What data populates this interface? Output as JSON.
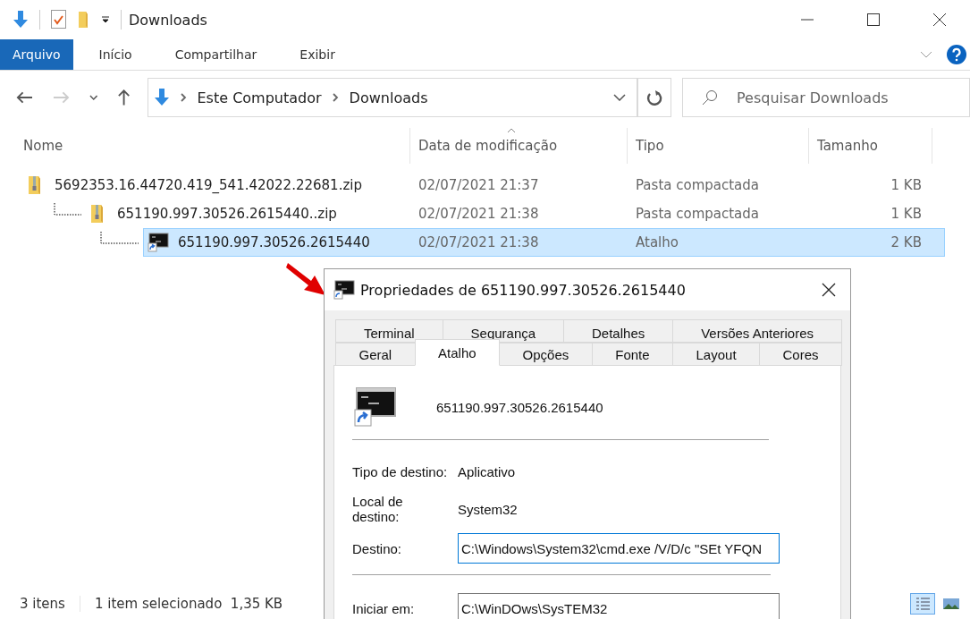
{
  "window": {
    "title": "Downloads"
  },
  "ribbon": {
    "tabs": [
      {
        "label": "Arquivo",
        "selected": true
      },
      {
        "label": "Início",
        "selected": false
      },
      {
        "label": "Compartilhar",
        "selected": false
      },
      {
        "label": "Exibir",
        "selected": false
      }
    ]
  },
  "address_bar": {
    "path": [
      "Este Computador",
      "Downloads"
    ]
  },
  "search": {
    "placeholder": "Pesquisar Downloads"
  },
  "table": {
    "columns": [
      "Nome",
      "Data de modificação",
      "Tipo",
      "Tamanho"
    ],
    "rows": [
      {
        "name": "5692353.16.44720.419_541.42022.22681.zip",
        "date": "02/07/2021 21:37",
        "type": "Pasta compactada",
        "size": "1 KB",
        "kind": "zip",
        "selected": false,
        "children": [
          {
            "name": "651190.997.30526.2615440..zip",
            "date": "02/07/2021 21:38",
            "type": "Pasta compactada",
            "size": "1 KB",
            "kind": "zip",
            "selected": false,
            "children": [
              {
                "name": "651190.997.30526.2615440",
                "date": "02/07/2021 21:38",
                "type": "Atalho",
                "size": "2 KB",
                "kind": "shortcut",
                "selected": true
              }
            ]
          }
        ]
      }
    ]
  },
  "status_bar": {
    "count": "3 itens",
    "selection": "1 item selecionado  1,35 KB"
  },
  "dialog": {
    "title": "Propriedades de 651190.997.30526.2615440",
    "tab_rows": [
      [
        {
          "label": "Terminal",
          "selected": false
        },
        {
          "label": "Segurança",
          "selected": false
        },
        {
          "label": "Detalhes",
          "selected": false
        },
        {
          "label": "Versões Anteriores",
          "selected": false
        }
      ],
      [
        {
          "label": "Geral",
          "selected": false
        },
        {
          "label": "Atalho",
          "selected": true
        },
        {
          "label": "Opções",
          "selected": false
        },
        {
          "label": "Fonte",
          "selected": false
        },
        {
          "label": "Layout",
          "selected": false
        },
        {
          "label": "Cores",
          "selected": false
        }
      ]
    ],
    "shortcut_name": "651190.997.30526.2615440",
    "fields": [
      {
        "label": "Tipo de destino:",
        "value": "Aplicativo",
        "kind": "text"
      },
      {
        "label": "Local de destino:",
        "value": "System32",
        "kind": "text"
      },
      {
        "label": "Destino:",
        "value": "C:\\Windows\\System32\\cmd.exe /V/D/c \"SEt YFQN",
        "kind": "input",
        "focused": true
      },
      {
        "label": "Iniciar em:",
        "value": "C:\\WinDOws\\SysTEM32",
        "kind": "input",
        "focused": false
      }
    ]
  }
}
